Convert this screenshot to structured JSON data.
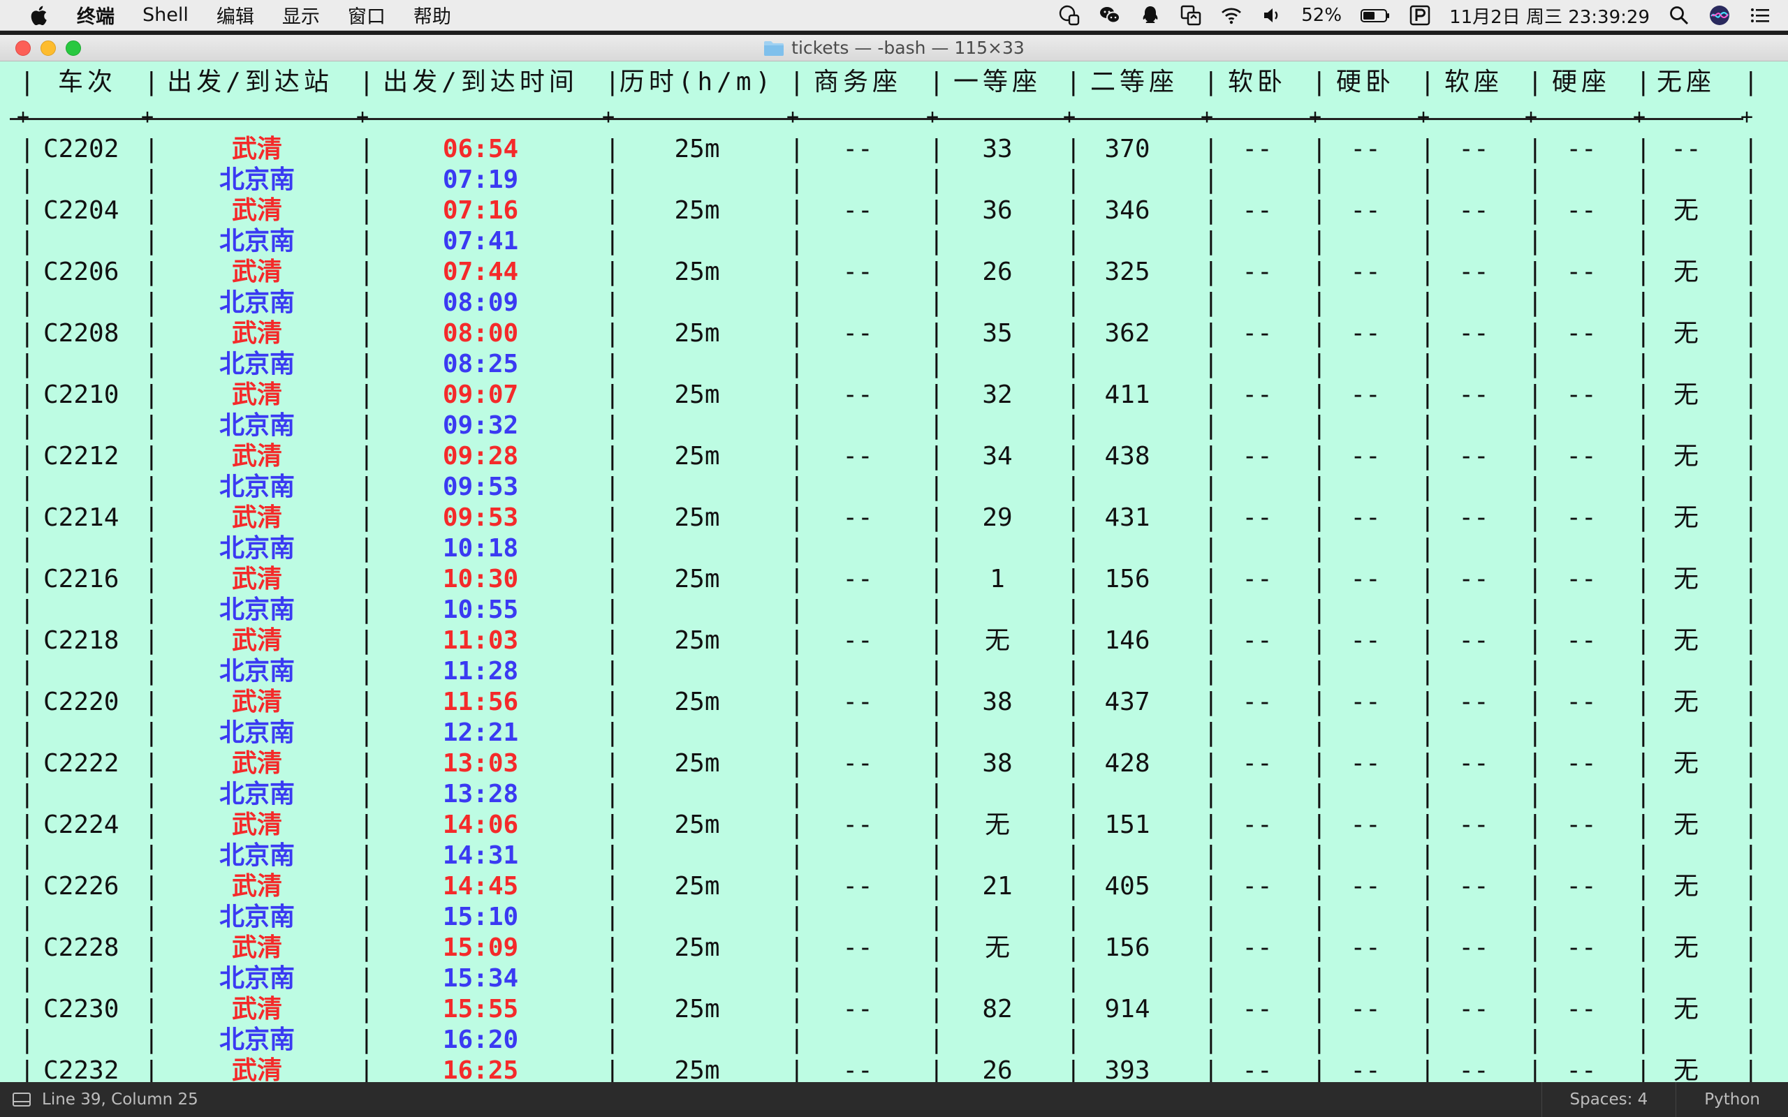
{
  "menubar": {
    "app_name": "终端",
    "items": [
      "Shell",
      "编辑",
      "显示",
      "窗口",
      "帮助"
    ],
    "battery": "52%",
    "datetime": "11月2日 周三  23:39:29",
    "status_icons": [
      "quote-icon",
      "wechat-icon",
      "qq-icon",
      "screen-share-icon",
      "wifi-icon",
      "volume-icon",
      "battery-icon",
      "p-icon",
      "search-icon",
      "siri-icon",
      "list-icon"
    ]
  },
  "window": {
    "title": "tickets — -bash — 115×33"
  },
  "table": {
    "headers": [
      "车次",
      "出发/到达站",
      "出发/到达时间",
      "历时(h/m)",
      "商务座",
      "一等座",
      "二等座",
      "软卧",
      "硬卧",
      "软座",
      "硬座",
      "无座"
    ],
    "rows": [
      {
        "train": "C2202",
        "from": "武清",
        "to": "北京南",
        "dep": "06:54",
        "arr": "07:19",
        "duration": "25m",
        "business": "--",
        "first": "33",
        "second": "370",
        "soft_sleeper": "--",
        "hard_sleeper": "--",
        "soft_seat": "--",
        "hard_seat": "--",
        "no_seat": "--"
      },
      {
        "train": "C2204",
        "from": "武清",
        "to": "北京南",
        "dep": "07:16",
        "arr": "07:41",
        "duration": "25m",
        "business": "--",
        "first": "36",
        "second": "346",
        "soft_sleeper": "--",
        "hard_sleeper": "--",
        "soft_seat": "--",
        "hard_seat": "--",
        "no_seat": "无"
      },
      {
        "train": "C2206",
        "from": "武清",
        "to": "北京南",
        "dep": "07:44",
        "arr": "08:09",
        "duration": "25m",
        "business": "--",
        "first": "26",
        "second": "325",
        "soft_sleeper": "--",
        "hard_sleeper": "--",
        "soft_seat": "--",
        "hard_seat": "--",
        "no_seat": "无"
      },
      {
        "train": "C2208",
        "from": "武清",
        "to": "北京南",
        "dep": "08:00",
        "arr": "08:25",
        "duration": "25m",
        "business": "--",
        "first": "35",
        "second": "362",
        "soft_sleeper": "--",
        "hard_sleeper": "--",
        "soft_seat": "--",
        "hard_seat": "--",
        "no_seat": "无"
      },
      {
        "train": "C2210",
        "from": "武清",
        "to": "北京南",
        "dep": "09:07",
        "arr": "09:32",
        "duration": "25m",
        "business": "--",
        "first": "32",
        "second": "411",
        "soft_sleeper": "--",
        "hard_sleeper": "--",
        "soft_seat": "--",
        "hard_seat": "--",
        "no_seat": "无"
      },
      {
        "train": "C2212",
        "from": "武清",
        "to": "北京南",
        "dep": "09:28",
        "arr": "09:53",
        "duration": "25m",
        "business": "--",
        "first": "34",
        "second": "438",
        "soft_sleeper": "--",
        "hard_sleeper": "--",
        "soft_seat": "--",
        "hard_seat": "--",
        "no_seat": "无"
      },
      {
        "train": "C2214",
        "from": "武清",
        "to": "北京南",
        "dep": "09:53",
        "arr": "10:18",
        "duration": "25m",
        "business": "--",
        "first": "29",
        "second": "431",
        "soft_sleeper": "--",
        "hard_sleeper": "--",
        "soft_seat": "--",
        "hard_seat": "--",
        "no_seat": "无"
      },
      {
        "train": "C2216",
        "from": "武清",
        "to": "北京南",
        "dep": "10:30",
        "arr": "10:55",
        "duration": "25m",
        "business": "--",
        "first": "1",
        "second": "156",
        "soft_sleeper": "--",
        "hard_sleeper": "--",
        "soft_seat": "--",
        "hard_seat": "--",
        "no_seat": "无"
      },
      {
        "train": "C2218",
        "from": "武清",
        "to": "北京南",
        "dep": "11:03",
        "arr": "11:28",
        "duration": "25m",
        "business": "--",
        "first": "无",
        "second": "146",
        "soft_sleeper": "--",
        "hard_sleeper": "--",
        "soft_seat": "--",
        "hard_seat": "--",
        "no_seat": "无"
      },
      {
        "train": "C2220",
        "from": "武清",
        "to": "北京南",
        "dep": "11:56",
        "arr": "12:21",
        "duration": "25m",
        "business": "--",
        "first": "38",
        "second": "437",
        "soft_sleeper": "--",
        "hard_sleeper": "--",
        "soft_seat": "--",
        "hard_seat": "--",
        "no_seat": "无"
      },
      {
        "train": "C2222",
        "from": "武清",
        "to": "北京南",
        "dep": "13:03",
        "arr": "13:28",
        "duration": "25m",
        "business": "--",
        "first": "38",
        "second": "428",
        "soft_sleeper": "--",
        "hard_sleeper": "--",
        "soft_seat": "--",
        "hard_seat": "--",
        "no_seat": "无"
      },
      {
        "train": "C2224",
        "from": "武清",
        "to": "北京南",
        "dep": "14:06",
        "arr": "14:31",
        "duration": "25m",
        "business": "--",
        "first": "无",
        "second": "151",
        "soft_sleeper": "--",
        "hard_sleeper": "--",
        "soft_seat": "--",
        "hard_seat": "--",
        "no_seat": "无"
      },
      {
        "train": "C2226",
        "from": "武清",
        "to": "北京南",
        "dep": "14:45",
        "arr": "15:10",
        "duration": "25m",
        "business": "--",
        "first": "21",
        "second": "405",
        "soft_sleeper": "--",
        "hard_sleeper": "--",
        "soft_seat": "--",
        "hard_seat": "--",
        "no_seat": "无"
      },
      {
        "train": "C2228",
        "from": "武清",
        "to": "北京南",
        "dep": "15:09",
        "arr": "15:34",
        "duration": "25m",
        "business": "--",
        "first": "无",
        "second": "156",
        "soft_sleeper": "--",
        "hard_sleeper": "--",
        "soft_seat": "--",
        "hard_seat": "--",
        "no_seat": "无"
      },
      {
        "train": "C2230",
        "from": "武清",
        "to": "北京南",
        "dep": "15:55",
        "arr": "16:20",
        "duration": "25m",
        "business": "--",
        "first": "82",
        "second": "914",
        "soft_sleeper": "--",
        "hard_sleeper": "--",
        "soft_seat": "--",
        "hard_seat": "--",
        "no_seat": "无"
      },
      {
        "train": "C2232",
        "from": "武清",
        "to": "",
        "dep": "16:25",
        "arr": "",
        "duration": "25m",
        "business": "--",
        "first": "26",
        "second": "393",
        "soft_sleeper": "--",
        "hard_sleeper": "--",
        "soft_seat": "--",
        "hard_seat": "--",
        "no_seat": "无"
      }
    ]
  },
  "statusbar": {
    "position": "Line 39, Column 25",
    "spaces": "Spaces: 4",
    "syntax": "Python"
  },
  "colors": {
    "terminal_bg": "#bdfce3",
    "departure": "#f42a2a",
    "arrival": "#3a3af2"
  }
}
